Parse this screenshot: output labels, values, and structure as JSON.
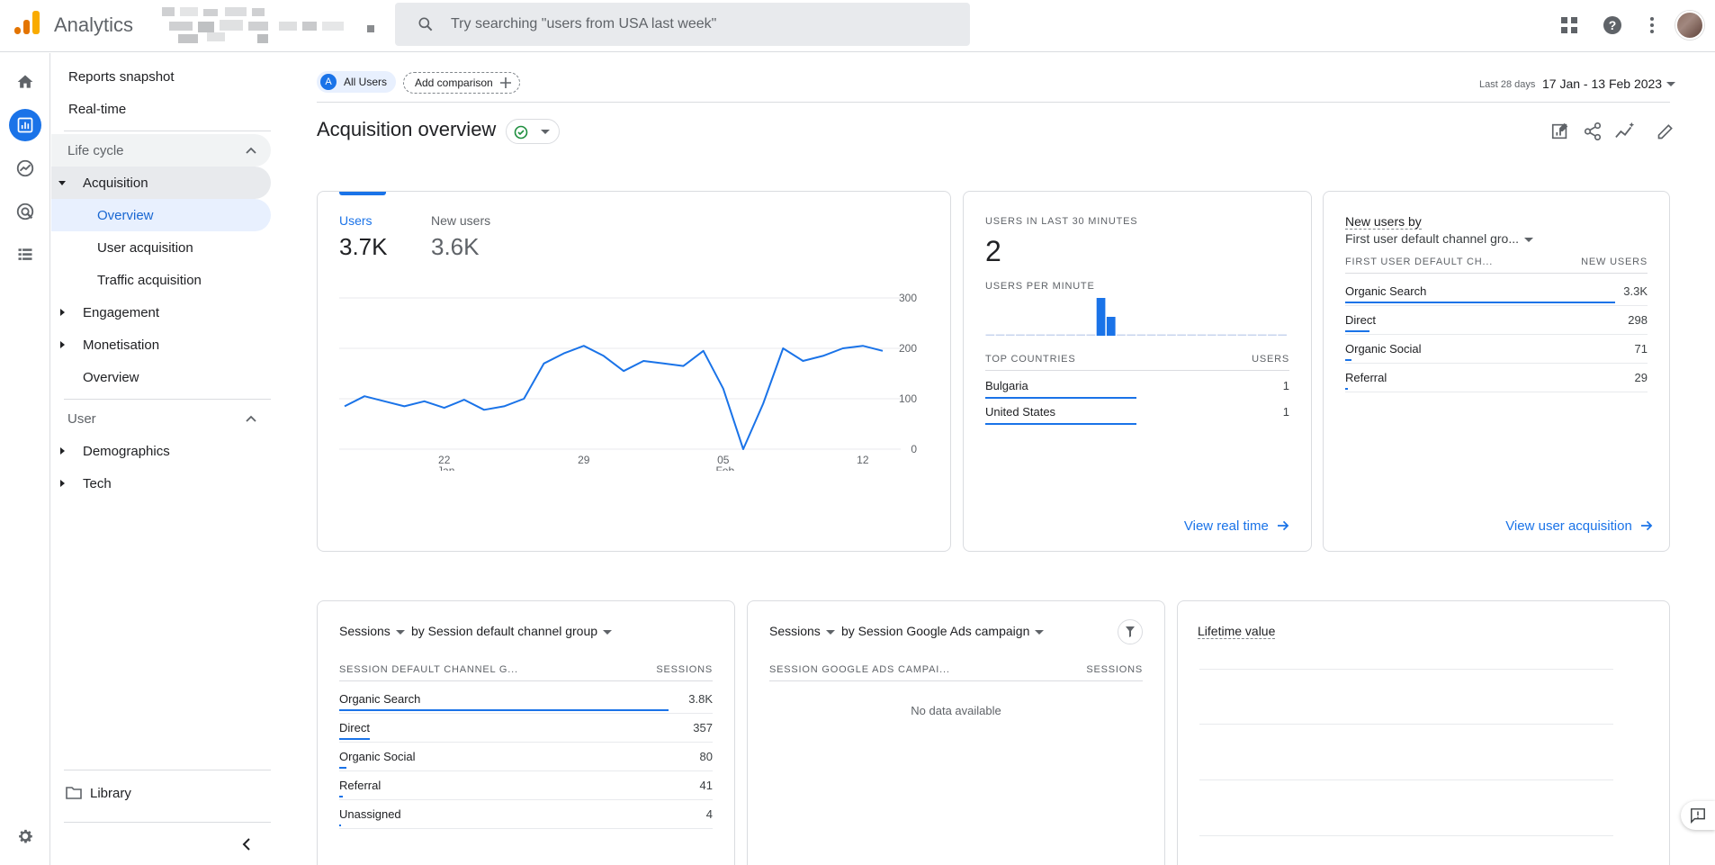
{
  "app": {
    "title": "Analytics"
  },
  "search": {
    "placeholder": "Try searching \"users from USA last week\""
  },
  "topbar_icons": [
    "apps-grid-icon",
    "help-icon",
    "more-vert-icon",
    "avatar"
  ],
  "nav": {
    "reports_snapshot": "Reports snapshot",
    "realtime": "Real-time",
    "lifecycle": "Life cycle",
    "acquisition": "Acquisition",
    "overview": "Overview",
    "user_acquisition": "User acquisition",
    "traffic_acquisition": "Traffic acquisition",
    "engagement": "Engagement",
    "monetisation": "Monetisation",
    "monetisation_overview": "Overview",
    "user": "User",
    "demographics": "Demographics",
    "tech": "Tech",
    "library": "Library"
  },
  "comparison": {
    "all_users_badge": "A",
    "all_users": "All Users",
    "add_comparison": "Add comparison"
  },
  "date": {
    "label": "Last 28 days",
    "range": "17 Jan - 13 Feb 2023"
  },
  "page": {
    "title": "Acquisition overview"
  },
  "users_card": {
    "tabs": [
      {
        "label": "Users",
        "value": "3.7K"
      },
      {
        "label": "New users",
        "value": "3.6K"
      }
    ]
  },
  "chart_data": {
    "type": "line",
    "series": [
      {
        "name": "Users",
        "values": [
          85,
          105,
          95,
          85,
          95,
          82,
          98,
          78,
          85,
          100,
          170,
          190,
          205,
          185,
          155,
          175,
          170,
          165,
          195,
          120,
          0,
          90,
          200,
          175,
          185,
          200,
          205,
          195
        ]
      }
    ],
    "x_tick_labels": [
      "22",
      "29",
      "05",
      "12"
    ],
    "x_tick_sublabels": [
      "Jan",
      "",
      "Feb",
      ""
    ],
    "y_tick_labels": [
      "300",
      "200",
      "100",
      "0"
    ],
    "ylim": [
      0,
      300
    ],
    "grid": true,
    "accent": "#1a73e8"
  },
  "realtime_card": {
    "users_label": "USERS IN LAST 30 MINUTES",
    "users_value": "2",
    "per_minute_label": "USERS PER MINUTE",
    "per_minute": [
      0,
      0,
      0,
      0,
      0,
      0,
      0,
      0,
      0,
      0,
      0,
      2,
      1,
      0,
      0,
      0,
      0,
      0,
      0,
      0,
      0,
      0,
      0,
      0,
      0,
      0,
      0,
      0,
      0,
      0
    ],
    "countries_header": "TOP COUNTRIES",
    "users_header": "USERS",
    "countries": [
      {
        "name": "Bulgaria",
        "value": "1",
        "share": 1.0
      },
      {
        "name": "United States",
        "value": "1",
        "share": 1.0
      }
    ],
    "link": "View real time"
  },
  "new_users_card": {
    "title": "New users by",
    "dimension": "First user default channel gro...",
    "col1": "FIRST USER DEFAULT CH...",
    "col2": "NEW USERS",
    "rows": [
      {
        "name": "Organic Search",
        "value": "3.3K",
        "share": 1.0
      },
      {
        "name": "Direct",
        "value": "298",
        "share": 0.09
      },
      {
        "name": "Organic Social",
        "value": "71",
        "share": 0.022
      },
      {
        "name": "Referral",
        "value": "29",
        "share": 0.009
      }
    ],
    "link": "View user acquisition"
  },
  "sessions_channel_card": {
    "metric": "Sessions",
    "dimension": "by Session default channel group",
    "col1": "SESSION DEFAULT CHANNEL G...",
    "col2": "SESSIONS",
    "rows": [
      {
        "name": "Organic Search",
        "value": "3.8K",
        "share": 1.0
      },
      {
        "name": "Direct",
        "value": "357",
        "share": 0.094
      },
      {
        "name": "Organic Social",
        "value": "80",
        "share": 0.021
      },
      {
        "name": "Referral",
        "value": "41",
        "share": 0.011
      },
      {
        "name": "Unassigned",
        "value": "4",
        "share": 0.001
      }
    ]
  },
  "sessions_ads_card": {
    "metric": "Sessions",
    "dimension": "by Session Google Ads campaign",
    "col1": "SESSION GOOGLE ADS CAMPAI...",
    "col2": "SESSIONS",
    "empty": "No data available"
  },
  "ltv_card": {
    "title": "Lifetime value"
  }
}
